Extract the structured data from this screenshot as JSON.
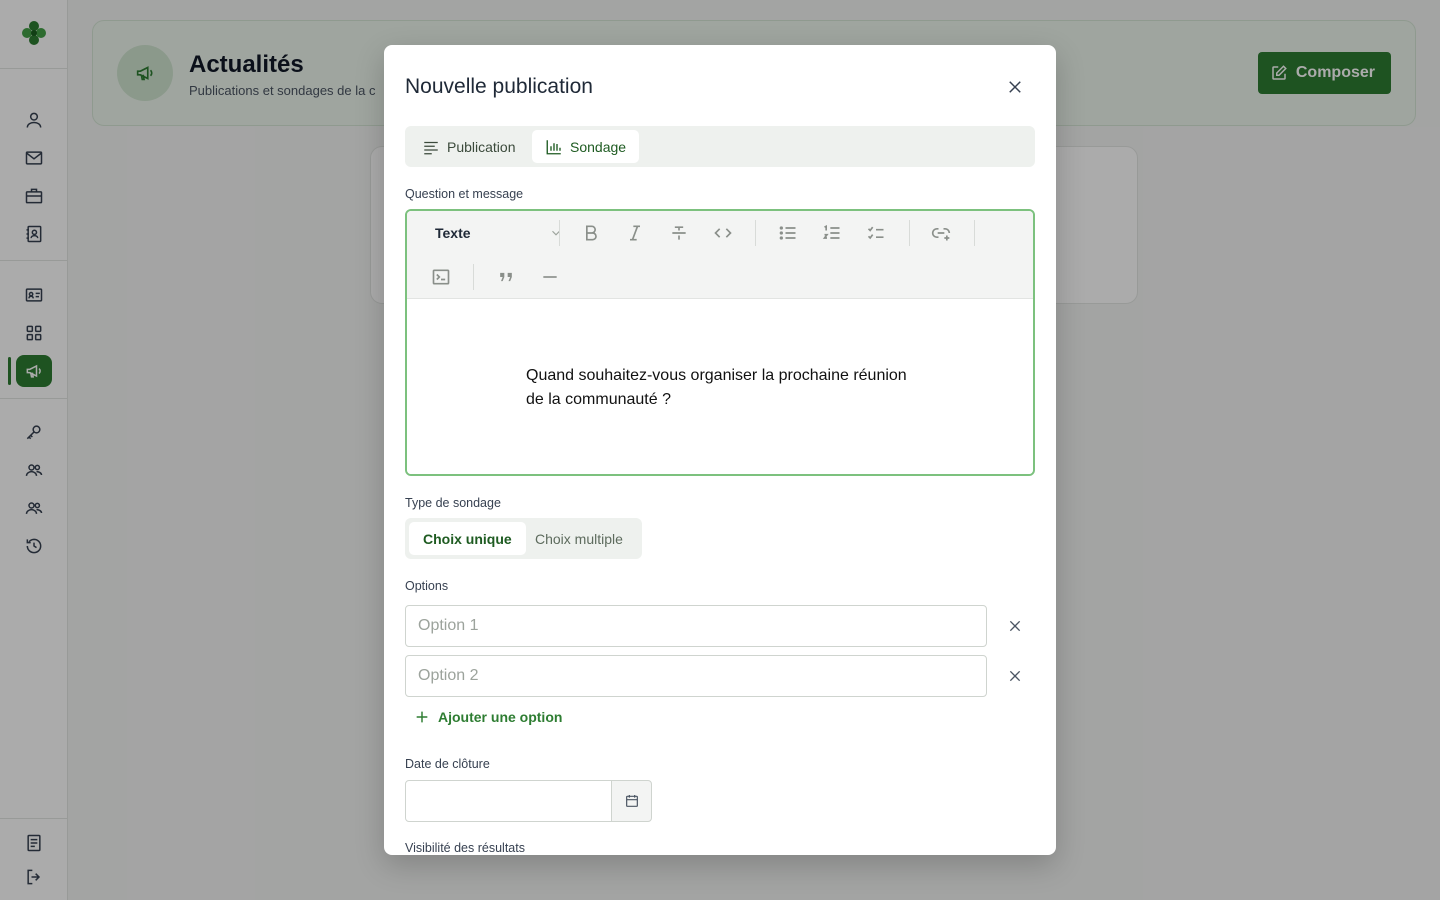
{
  "colors": {
    "accent": "#2e7d32",
    "focus_border": "#7cc17e",
    "overlay": "rgba(0,0,0,0.33)"
  },
  "sidebar": {
    "logo": "clover-logo",
    "items": [
      {
        "icon": "user-icon"
      },
      {
        "icon": "mail-icon"
      },
      {
        "icon": "briefcase-icon"
      },
      {
        "icon": "contact-book-icon"
      },
      {
        "icon": "id-card-icon"
      },
      {
        "icon": "grid-icon"
      },
      {
        "icon": "megaphone-icon",
        "active": true
      },
      {
        "icon": "key-icon"
      },
      {
        "icon": "users-icon"
      },
      {
        "icon": "users-alt-icon"
      },
      {
        "icon": "history-icon"
      },
      {
        "icon": "document-icon"
      },
      {
        "icon": "logout-icon"
      }
    ]
  },
  "header": {
    "title": "Actualités",
    "subtitle": "Publications et sondages de la c",
    "compose_label": "Composer"
  },
  "modal": {
    "title": "Nouvelle publication",
    "tabs": [
      {
        "label": "Publication",
        "active": false
      },
      {
        "label": "Sondage",
        "active": true
      }
    ],
    "question_label": "Question et message",
    "editor": {
      "block_type": "Texte",
      "content_line1": "Quand souhaitez-vous organiser la prochaine réunion",
      "content_line2": "de la communauté ?"
    },
    "poll_type_label": "Type de sondage",
    "poll_types": [
      {
        "label": "Choix unique",
        "active": true
      },
      {
        "label": "Choix multiple",
        "active": false
      }
    ],
    "options_label": "Options",
    "options": [
      {
        "placeholder": "Option 1",
        "value": ""
      },
      {
        "placeholder": "Option 2",
        "value": ""
      }
    ],
    "add_option_label": "Ajouter une option",
    "closing_date_label": "Date de clôture",
    "closing_date_value": "",
    "results_visibility_label": "Visibilité des résultats"
  }
}
